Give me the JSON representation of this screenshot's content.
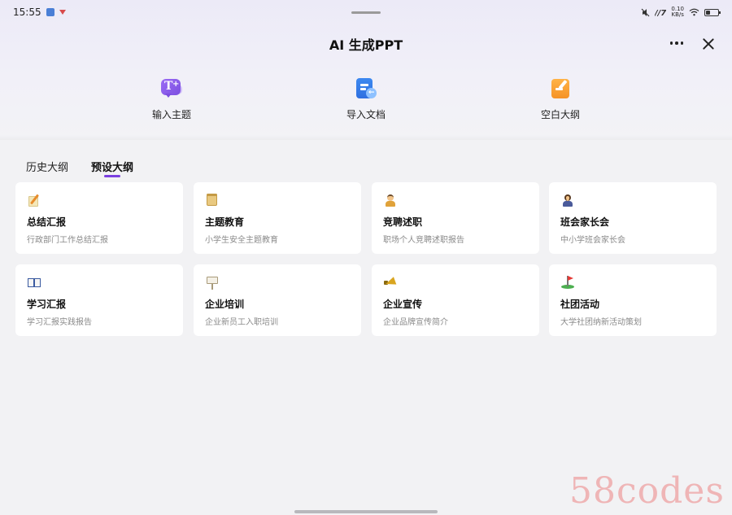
{
  "status_bar": {
    "time": "15:55",
    "right_small_top": "0.10",
    "right_small_bottom": "KB/s"
  },
  "header": {
    "title": "AI 生成PPT"
  },
  "actions": [
    {
      "label": "输入主题",
      "icon": "topic-input-icon"
    },
    {
      "label": "导入文档",
      "icon": "import-doc-icon"
    },
    {
      "label": "空白大纲",
      "icon": "blank-outline-icon"
    }
  ],
  "tabs": [
    {
      "label": "历史大纲",
      "active": false
    },
    {
      "label": "预设大纲",
      "active": true
    }
  ],
  "cards": [
    {
      "title": "总结汇报",
      "desc": "行政部门工作总结汇报",
      "icon": "memo-icon"
    },
    {
      "title": "主题教育",
      "desc": "小学生安全主题教育",
      "icon": "scroll-icon"
    },
    {
      "title": "竞聘述职",
      "desc": "职场个人竞聘述职报告",
      "icon": "person-icon"
    },
    {
      "title": "班会家长会",
      "desc": "中小学班会家长会",
      "icon": "teacher-icon"
    },
    {
      "title": "学习汇报",
      "desc": "学习汇报实践报告",
      "icon": "book-icon"
    },
    {
      "title": "企业培训",
      "desc": "企业新员工入职培训",
      "icon": "signboard-icon"
    },
    {
      "title": "企业宣传",
      "desc": "企业品牌宣传简介",
      "icon": "megaphone-icon"
    },
    {
      "title": "社团活动",
      "desc": "大学社团纳新活动策划",
      "icon": "golf-flag-icon"
    }
  ],
  "watermark": "58codes",
  "colors": {
    "accent": "#7b3fe0",
    "background": "#f2f2f4",
    "card": "#ffffff"
  }
}
